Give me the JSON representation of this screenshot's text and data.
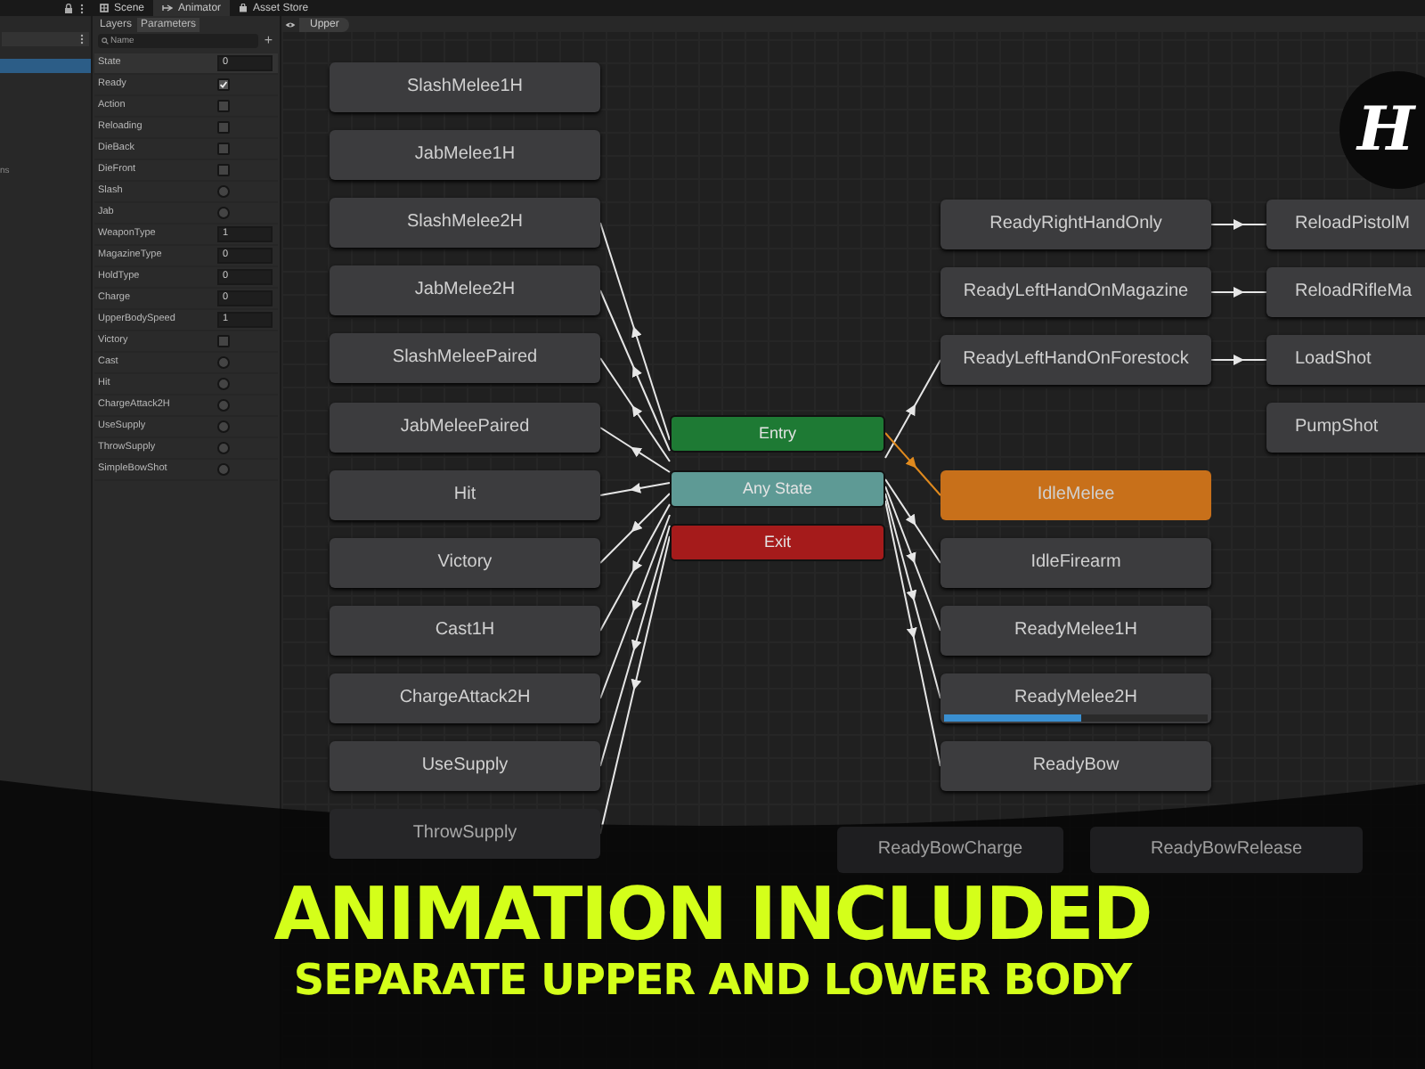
{
  "top_tabs": [
    {
      "label": "Scene",
      "selected": false,
      "kind": "scene"
    },
    {
      "label": "Animator",
      "selected": true,
      "kind": "animator"
    },
    {
      "label": "Asset Store",
      "selected": false,
      "kind": "store"
    }
  ],
  "hierarchy": {
    "truncated_label": "ns"
  },
  "parameters_panel": {
    "tabs": [
      {
        "label": "Layers",
        "selected": false
      },
      {
        "label": "Parameters",
        "selected": true
      }
    ],
    "search": {
      "placeholder": "Name"
    },
    "add_button": "+",
    "items": [
      {
        "name": "State",
        "kind": "int",
        "value": "0"
      },
      {
        "name": "Ready",
        "kind": "bool",
        "checked": true
      },
      {
        "name": "Action",
        "kind": "bool",
        "checked": false
      },
      {
        "name": "Reloading",
        "kind": "bool",
        "checked": false
      },
      {
        "name": "DieBack",
        "kind": "bool",
        "checked": false
      },
      {
        "name": "DieFront",
        "kind": "bool",
        "checked": false
      },
      {
        "name": "Slash",
        "kind": "trigger",
        "checked": false
      },
      {
        "name": "Jab",
        "kind": "trigger",
        "checked": false
      },
      {
        "name": "WeaponType",
        "kind": "int",
        "value": "1"
      },
      {
        "name": "MagazineType",
        "kind": "int",
        "value": "0"
      },
      {
        "name": "HoldType",
        "kind": "int",
        "value": "0"
      },
      {
        "name": "Charge",
        "kind": "int",
        "value": "0"
      },
      {
        "name": "UpperBodySpeed",
        "kind": "float",
        "value": "1"
      },
      {
        "name": "Victory",
        "kind": "bool",
        "checked": false
      },
      {
        "name": "Cast",
        "kind": "trigger",
        "checked": false
      },
      {
        "name": "Hit",
        "kind": "trigger",
        "checked": false
      },
      {
        "name": "ChargeAttack2H",
        "kind": "trigger",
        "checked": false
      },
      {
        "name": "UseSupply",
        "kind": "trigger",
        "checked": false
      },
      {
        "name": "ThrowSupply",
        "kind": "trigger",
        "checked": false
      },
      {
        "name": "SimpleBowShot",
        "kind": "trigger",
        "checked": false
      }
    ]
  },
  "graph": {
    "breadcrumb": "Upper",
    "left_states": [
      "SlashMelee1H",
      "JabMelee1H",
      "SlashMelee2H",
      "JabMelee2H",
      "SlashMeleePaired",
      "JabMeleePaired",
      "Hit",
      "Victory",
      "Cast1H",
      "ChargeAttack2H",
      "UseSupply",
      "ThrowSupply"
    ],
    "center_states": [
      {
        "label": "Entry",
        "kind": "entry"
      },
      {
        "label": "Any State",
        "kind": "any"
      },
      {
        "label": "Exit",
        "kind": "exit"
      }
    ],
    "right_states": [
      {
        "label": "ReadyRightHandOnly",
        "default": false
      },
      {
        "label": "ReadyLeftHandOnMagazine",
        "default": false
      },
      {
        "label": "ReadyLeftHandOnForestock",
        "default": false
      },
      {
        "label": "IdleMelee",
        "default": true
      },
      {
        "label": "IdleFirearm",
        "default": false
      },
      {
        "label": "ReadyMelee1H",
        "default": false
      },
      {
        "label": "ReadyMelee2H",
        "default": false,
        "level": 0.52
      },
      {
        "label": "ReadyBow",
        "default": false
      }
    ],
    "far_right_states": [
      "ReloadPistolM",
      "ReloadRifleMa",
      "LoadShot",
      "PumpShot"
    ],
    "faded_states": [
      "ReadyBowCharge",
      "ReadyBowRelease"
    ]
  },
  "logo": {
    "text": "H"
  },
  "banner": {
    "title": "ANIMATION INCLUDED",
    "subtitle": "SEPARATE UPPER AND LOWER BODY"
  }
}
